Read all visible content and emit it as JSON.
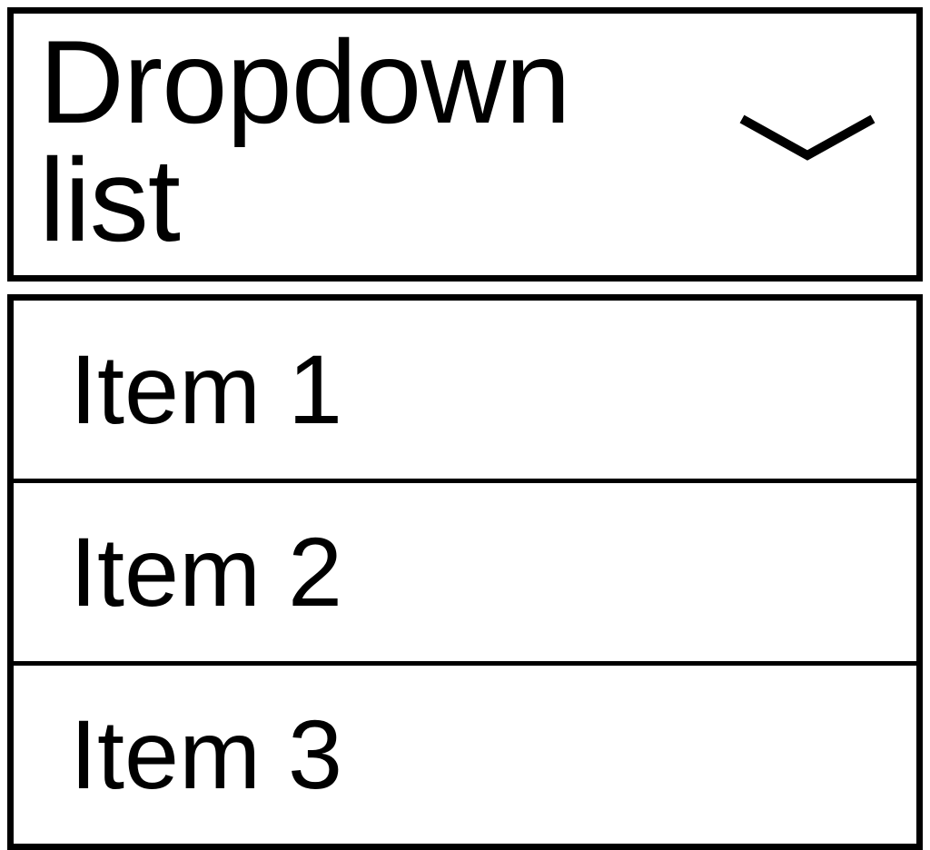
{
  "dropdown": {
    "label": "Dropdown list",
    "items": [
      {
        "label": "Item 1"
      },
      {
        "label": "Item 2"
      },
      {
        "label": "Item 3"
      }
    ]
  }
}
